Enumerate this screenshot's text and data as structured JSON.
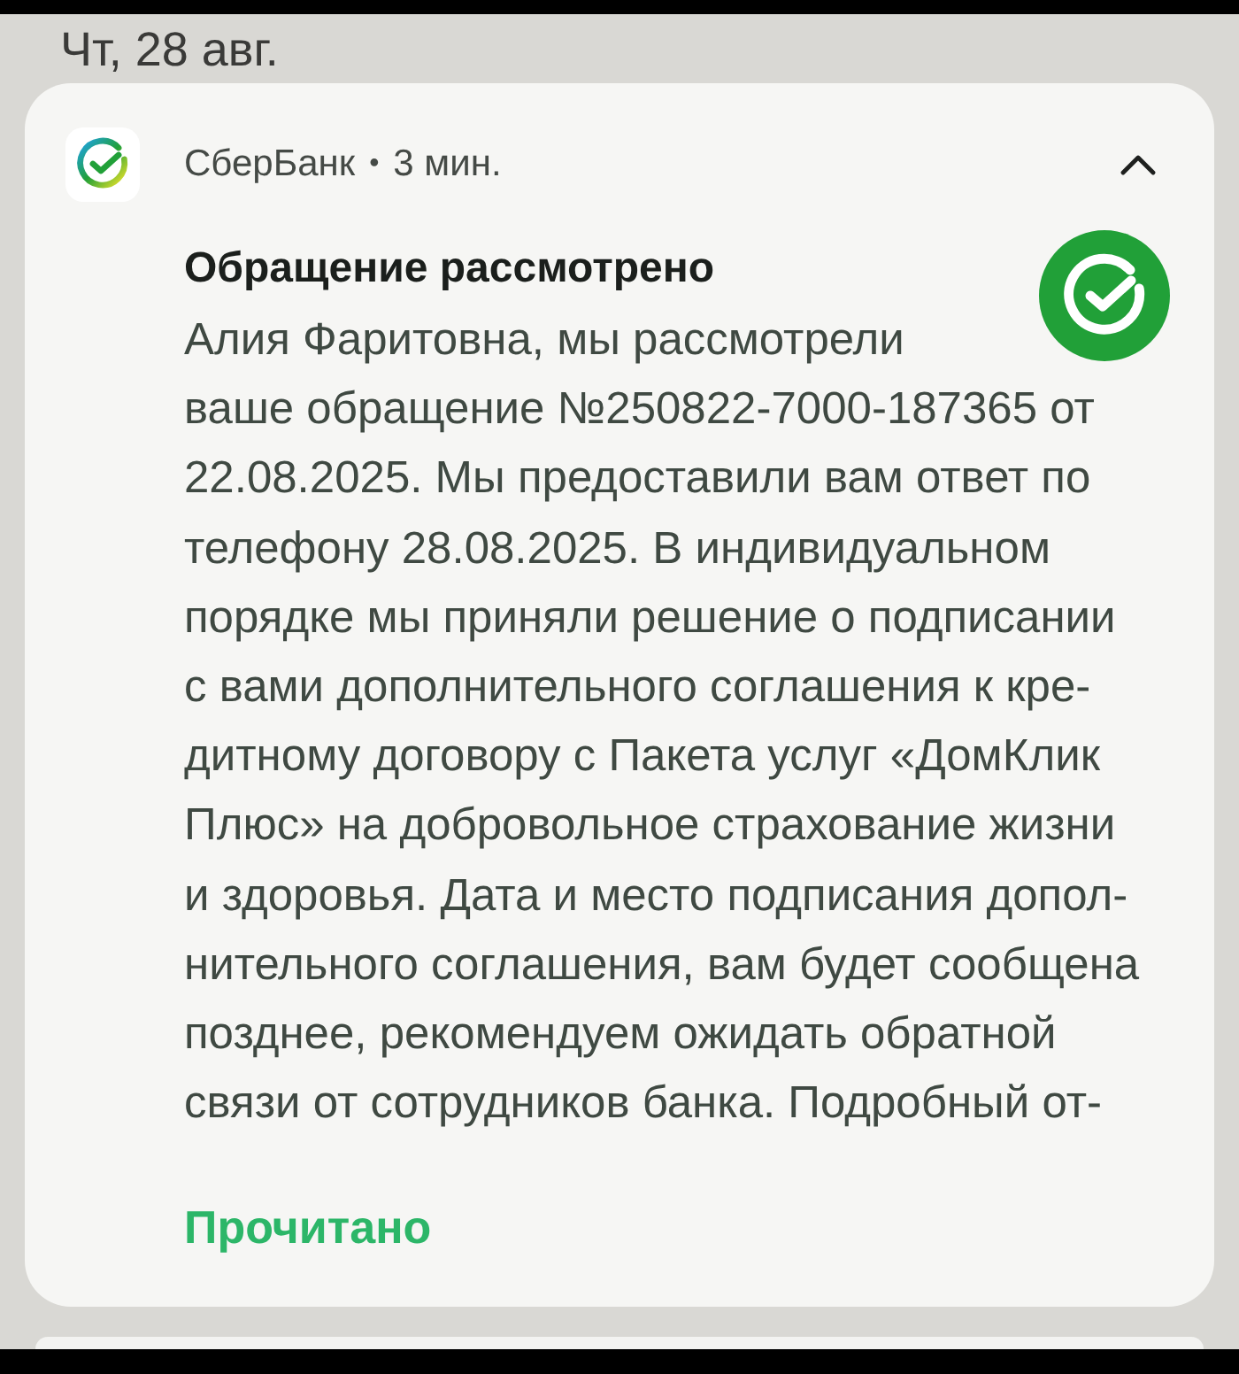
{
  "date_header": "Чт, 28 авг.",
  "notification": {
    "app_name": "СберБанк",
    "separator": "•",
    "time": "3 мин.",
    "expanded": true,
    "title": "Обращение рассмотрено",
    "body_lines": [
      "Алия Фаритовна, мы рассмотрели",
      "ваше обращение №250822-7000-187365 от",
      "22.08.2025. Мы предоставили вам ответ по",
      "телефону 28.08.2025. В индивидуальном",
      "порядке мы приняли решение о подписании",
      "с вами дополнительного соглашения к кре-",
      "дитному договору с Пакета услуг «ДомКлик",
      "Плюс» на добровольное страхование жизни",
      "и здоровья. Дата и место подписания допол-",
      "нительного соглашения, вам будет сообщена",
      "позднее, рекомендуем ожидать обратной",
      "связи от сотрудников банка. Подробный от-"
    ],
    "action": "Прочитано"
  }
}
